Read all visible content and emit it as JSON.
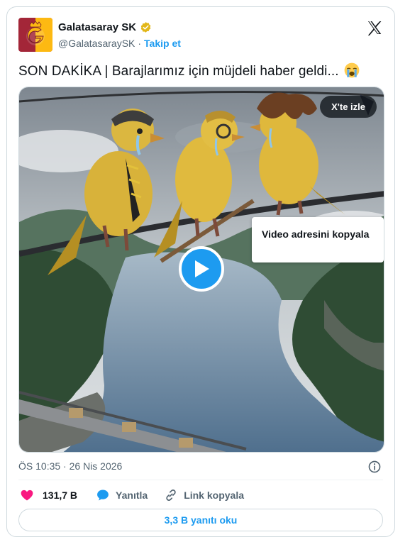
{
  "author": {
    "name": "Galatasaray SK",
    "handle": "@GalatasaraySK",
    "separator": "·",
    "follow_label": "Takip et"
  },
  "tweet": {
    "text": "SON DAKİKA | Barajlarımız için müjdeli haber geldi...",
    "emoji_icon": "loudly-crying-face-icon"
  },
  "media": {
    "watch_label": "X'te izle",
    "copy_popup_label": "Video adresini kopyala"
  },
  "meta": {
    "time": "ÖS 10:35",
    "separator": "·",
    "date": "26 Nis 2026"
  },
  "actions": {
    "like_count": "131,7 B",
    "reply_label": "Yanıtla",
    "copy_link_label": "Link kopyala"
  },
  "read_replies_label": "3,3 B yanıtı oku",
  "colors": {
    "accent": "#1d9bf0",
    "like": "#f91880",
    "club_red": "#a32638",
    "club_yellow": "#fdb912"
  }
}
